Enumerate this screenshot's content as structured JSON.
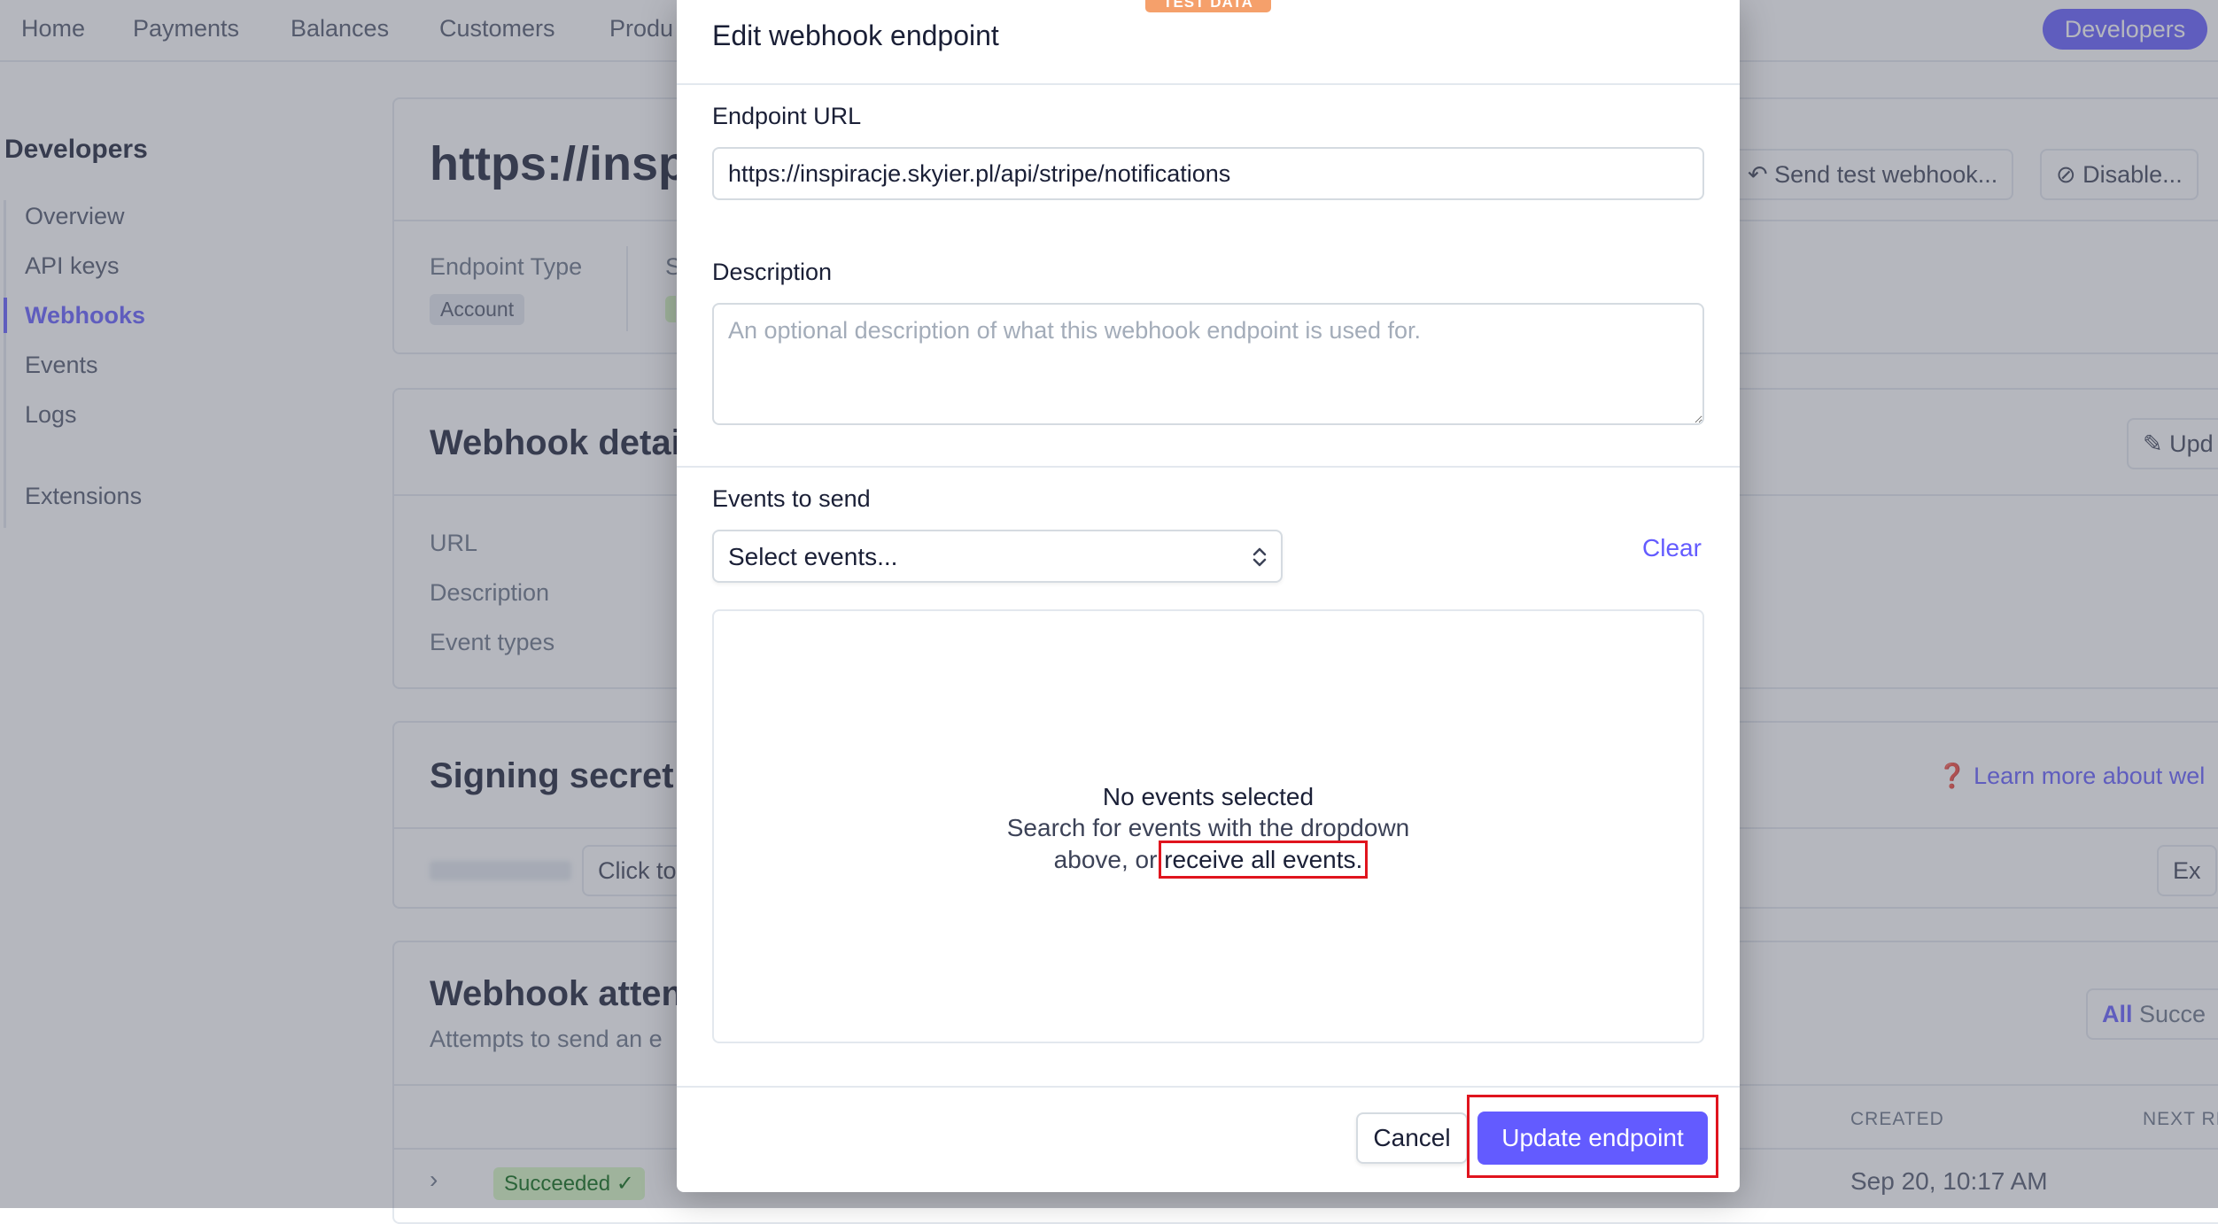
{
  "nav": {
    "items": [
      "Home",
      "Payments",
      "Balances",
      "Customers",
      "Produ"
    ],
    "developers_pill": "Developers"
  },
  "sidebar": {
    "heading": "Developers",
    "items": [
      "Overview",
      "API keys",
      "Webhooks",
      "Events",
      "Logs",
      "Extensions"
    ],
    "active": "Webhooks"
  },
  "endpoint_card": {
    "title": "https://insp",
    "send_test": "Send test webhook...",
    "disable": "Disable...",
    "endpoint_type_label": "Endpoint Type",
    "status_label_fragment": "S",
    "account_badge": "Account"
  },
  "details_card": {
    "title": "Webhook detai",
    "update_button": "Upd",
    "labels": [
      "URL",
      "Description",
      "Event types"
    ]
  },
  "secret_card": {
    "title": "Signing secret",
    "learn_more": "Learn more about wel",
    "click_to": "Click to",
    "export": "Ex"
  },
  "attempts_card": {
    "title": "Webhook atten",
    "subtitle": "Attempts to send an e",
    "filter_all": "All",
    "filter_succeeded": "Succe",
    "col_created": "CREATED",
    "col_next": "NEXT RI",
    "row_status": "Succeeded ✓",
    "row_created": "Sep 20, 10:17 AM"
  },
  "modal": {
    "badge": "TEST DATA",
    "title": "Edit webhook endpoint",
    "url_label": "Endpoint URL",
    "url_value": "https://inspiracje.skyier.pl/api/stripe/notifications",
    "description_label": "Description",
    "description_placeholder": "An optional description of what this webhook endpoint is used for.",
    "events_label": "Events to send",
    "select_placeholder": "Select events...",
    "clear": "Clear",
    "empty_title": "No events selected",
    "empty_line1": "Search for events with the dropdown",
    "empty_line2_prefix": "above, or ",
    "receive_all_link": "receive all events.",
    "cancel": "Cancel",
    "update": "Update endpoint"
  },
  "colors": {
    "accent": "#635bff",
    "highlight": "#e0141e",
    "test_badge": "#f5a06b"
  }
}
